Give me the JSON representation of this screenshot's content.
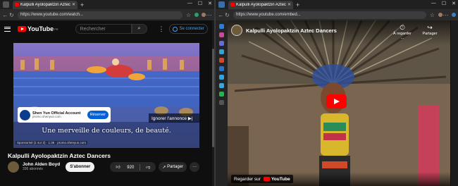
{
  "left_window": {
    "tab_title": "Kalpulli Ayolopaktzin Aztec Dancers",
    "url": "https://www.youtube.com/watch...",
    "yt_logo_text": "YouTube",
    "yt_logo_sup": "FR",
    "search_placeholder": "Rechercher",
    "signin_label": "Se connecter",
    "ad": {
      "account_name": "Shen Yun Official Account",
      "account_url": "promo.shenyun.com",
      "reserve_label": "Réserver",
      "skip_label": "Ignorer l'annonce ▶|",
      "caption": "Une merveille de couleurs, de beauté.",
      "sponsor_line": "Sponsorisé (1 sur 2) · 1:36 · promo.shenyun.com"
    },
    "video_title": "Kalpulli Ayolopaktzin Aztec Dancers",
    "channel_name": "John Alden Boyd",
    "channel_subs": "336 abonnés",
    "subscribe_label": "S'abonner",
    "like_count": "920",
    "share_label": "Partager",
    "more_label": "···"
  },
  "right_window": {
    "tab_title": "Kalpulli Ayolopaktzin Aztec Dancers",
    "url": "https://www.youtube.com/embed...",
    "embed_title": "Kalpulli Ayolopaktzin Aztec Dancers",
    "watch_later_label": "À regarder ...",
    "share_label": "Partager",
    "watch_on_label": "Regarder sur",
    "yt_label": "YouTube"
  },
  "colors": {
    "accent_red": "#ff0000",
    "link_blue": "#3ea6ff",
    "reserve_blue": "#065fd4"
  }
}
